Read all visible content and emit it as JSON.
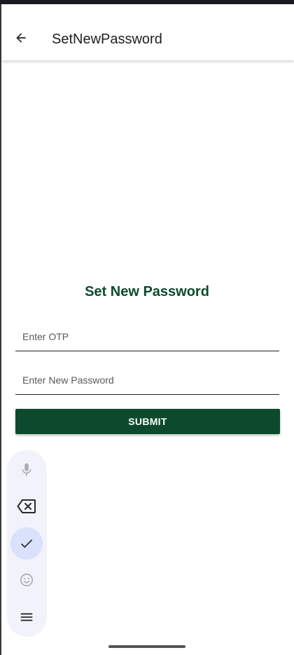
{
  "app_bar": {
    "title": "SetNewPassword",
    "back_icon": "arrow-left-icon"
  },
  "form": {
    "heading": "Set New Password",
    "otp_placeholder": "Enter OTP",
    "otp_value": "",
    "password_placeholder": "Enter New Password",
    "password_value": "",
    "submit_label": "SUBMIT"
  },
  "keyboard_toolbar": {
    "items": [
      {
        "icon": "microphone-icon",
        "state": "disabled"
      },
      {
        "icon": "backspace-icon",
        "state": "enabled"
      },
      {
        "icon": "checkmark-icon",
        "state": "active"
      },
      {
        "icon": "emoji-icon",
        "state": "disabled"
      },
      {
        "icon": "menu-icon",
        "state": "enabled"
      }
    ]
  },
  "colors": {
    "accent": "#0d4a2c",
    "toolbar_bg": "#f1f2fa",
    "toolbar_active": "#d9e1fb"
  }
}
